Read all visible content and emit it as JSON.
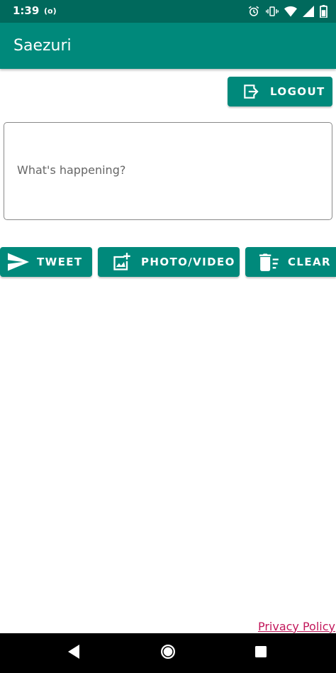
{
  "status_bar": {
    "time": "1:39",
    "radio_indicator": "(o)",
    "icons": [
      "alarm-icon",
      "vibrate-icon",
      "wifi-icon",
      "signal-icon",
      "battery-icon"
    ]
  },
  "app_bar": {
    "title": "Saezuri"
  },
  "toolbar": {
    "logout_label": "LOGOUT",
    "logout_icon": "exit-to-app-icon"
  },
  "composer": {
    "placeholder": "What's happening?",
    "value": ""
  },
  "actions": {
    "tweet_label": "TWEET",
    "tweet_icon": "send-icon",
    "photo_label": "PHOTO/VIDEO",
    "photo_icon": "add-photo-icon",
    "clear_label": "CLEAR",
    "clear_icon": "delete-sweep-icon"
  },
  "footer": {
    "privacy_label": "Privacy Policy"
  },
  "nav_bar": {
    "icons": [
      "back-icon",
      "home-icon",
      "recents-icon"
    ]
  },
  "colors": {
    "status_bar": "#00695c",
    "primary": "#00897b",
    "link": "#c2185b",
    "nav_bar": "#000000"
  }
}
